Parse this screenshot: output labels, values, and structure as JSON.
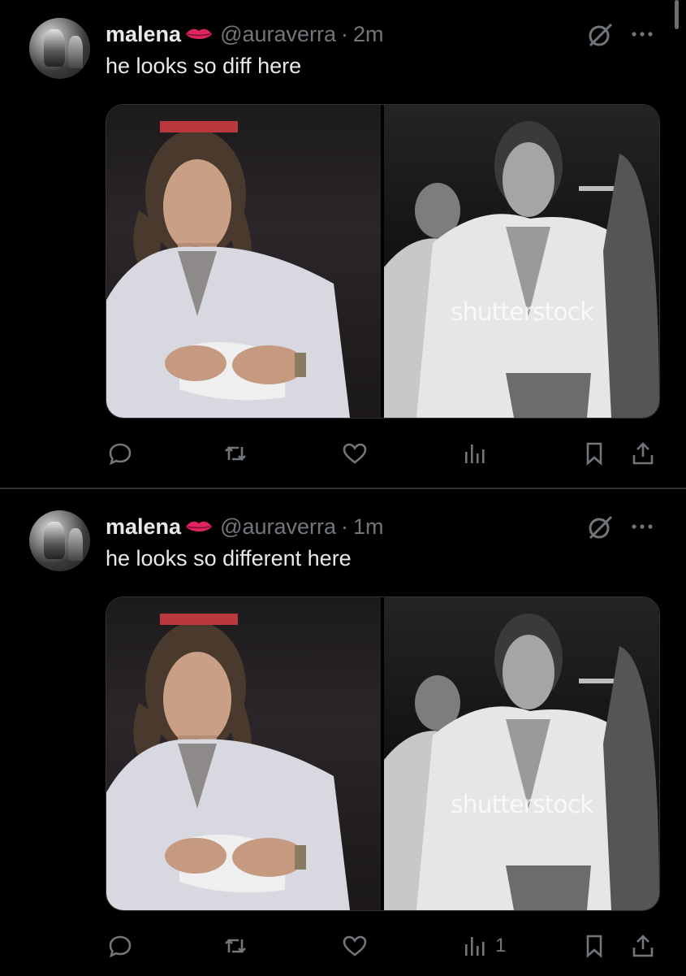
{
  "posts": [
    {
      "name": "malena",
      "handle": "@auraverra",
      "separator": "·",
      "time": "2m",
      "text": "he looks so diff here",
      "watermark": "shutterstock",
      "stats": {
        "views": ""
      }
    },
    {
      "name": "malena",
      "handle": "@auraverra",
      "separator": "·",
      "time": "1m",
      "text": "he looks so different here",
      "watermark": "shutterstock",
      "stats": {
        "views": "1"
      }
    }
  ],
  "icons": {
    "verified_emoji": "kiss-lips-icon",
    "grok": "grok-icon",
    "more": "more-icon",
    "reply": "reply-icon",
    "repost": "repost-icon",
    "like": "heart-icon",
    "views": "views-icon",
    "bookmark": "bookmark-icon",
    "share": "share-icon"
  },
  "colors": {
    "background": "#000000",
    "text": "#e7e9ea",
    "muted": "#71767b",
    "lips": "#e0245e"
  }
}
